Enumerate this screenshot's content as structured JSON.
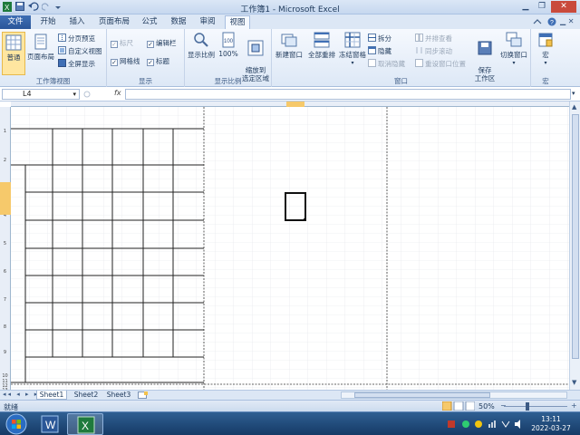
{
  "window": {
    "title": "工作簿1 - Microsoft Excel"
  },
  "ribbon_tabs": [
    "文件",
    "开始",
    "插入",
    "页面布局",
    "公式",
    "数据",
    "审阅",
    "视图"
  ],
  "ribbon": {
    "workbook_views": {
      "label": "工作簿视图",
      "normal": "普通",
      "page_layout": "页面布局",
      "page_break": "分页预览",
      "custom_views": "自定义视图",
      "full_screen": "全屏显示"
    },
    "show": {
      "label": "显示",
      "ruler": "标尺",
      "gridlines": "网格线",
      "formula_bar": "编辑栏",
      "headings": "标题"
    },
    "zoom": {
      "label": "显示比例",
      "zoom": "显示比例",
      "hundred": "100%",
      "zoom_to_selection": "缩放到\n选定区域"
    },
    "window": {
      "label": "窗口",
      "new_window": "新建窗口",
      "arrange_all": "全部重排",
      "freeze_panes": "冻结窗格",
      "split": "拆分",
      "hide": "隐藏",
      "unhide": "取消隐藏",
      "side_by_side": "并排查看",
      "sync_scroll": "同步滚动",
      "reset_position": "重设窗口位置",
      "save_workspace": "保存\n工作区",
      "switch_windows": "切换窗口"
    },
    "macros": {
      "label": "宏",
      "macros": "宏"
    }
  },
  "formula_bar": {
    "name_box": "L4",
    "fx": "fx",
    "value": ""
  },
  "row_headers": [
    "1",
    "2",
    "3",
    "4",
    "5",
    "6",
    "7",
    "8",
    "9",
    "10",
    "11",
    "12",
    "13"
  ],
  "sheet_tabs": [
    "Sheet1",
    "Sheet2",
    "Sheet3"
  ],
  "status": {
    "ready": "就绪",
    "zoom": "50%"
  },
  "taskbar": {
    "time": "13:11",
    "date": "2022-03-27"
  },
  "colors": {
    "accent": "#2a5699",
    "ribbon_bg": "#dde8f6",
    "taskbar": "#1d4675"
  }
}
